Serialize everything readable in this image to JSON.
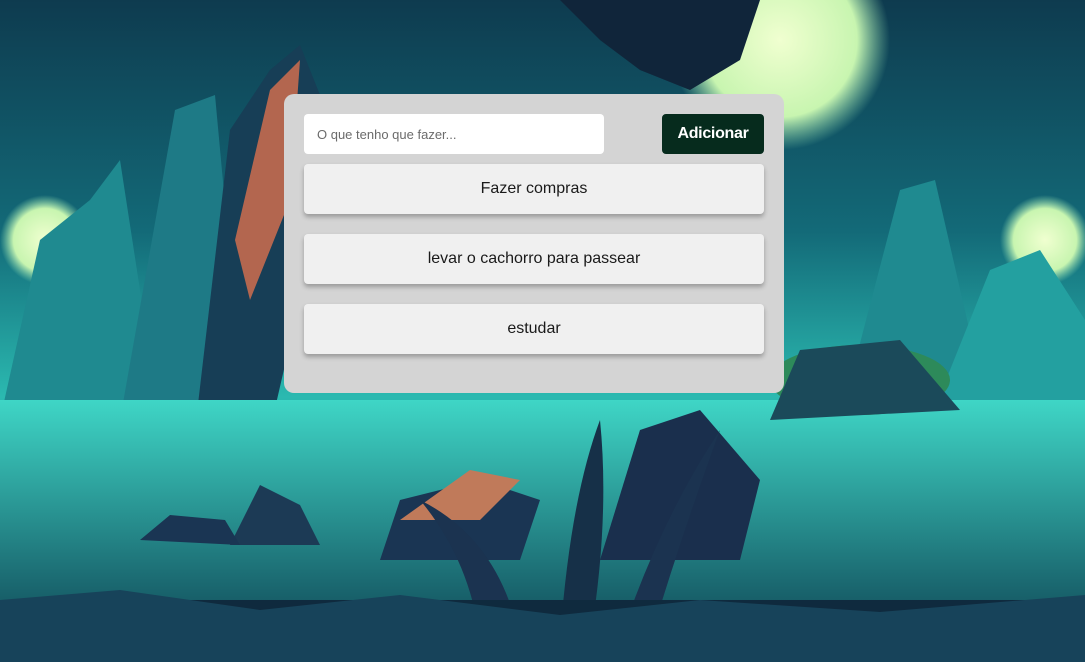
{
  "colors": {
    "panel_background": "#d4d4d4",
    "add_button_background": "#062b1d",
    "task_item_background": "#f0f0f0"
  },
  "new_task": {
    "placeholder": "O que tenho que fazer...",
    "value": "",
    "add_button_label": "Adicionar"
  },
  "tasks": [
    {
      "label": "Fazer compras"
    },
    {
      "label": "levar o cachorro para passear"
    },
    {
      "label": "estudar"
    }
  ]
}
